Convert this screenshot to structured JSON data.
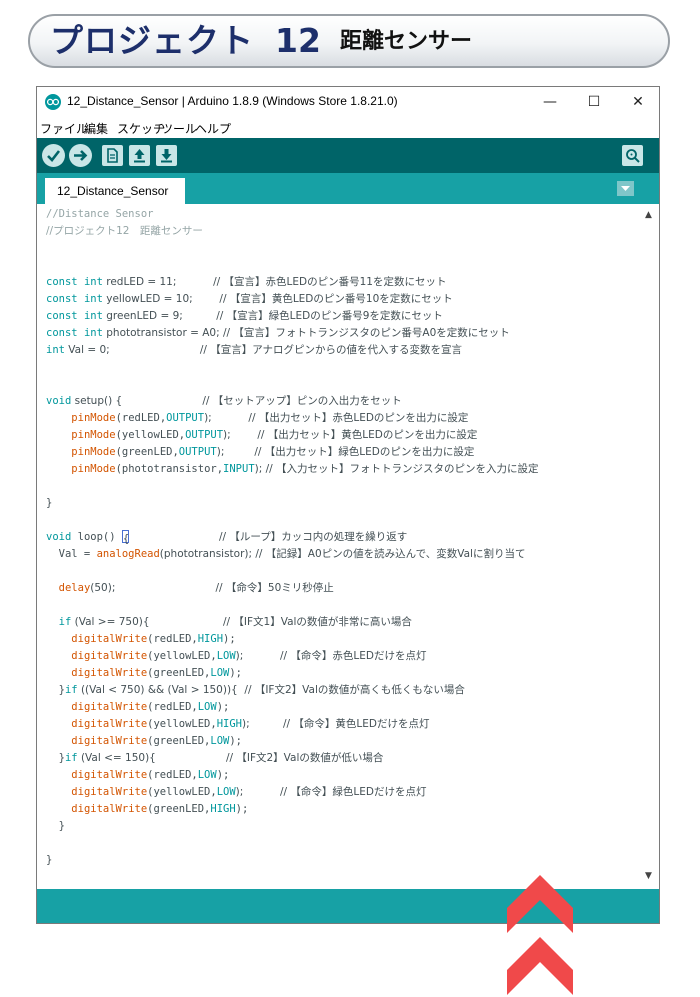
{
  "banner": {
    "project": "プロジェクト",
    "number": "12",
    "subtitle": "距離センサー"
  },
  "window": {
    "title": "12_Distance_Sensor | Arduino 1.8.9 (Windows Store 1.8.21.0)",
    "controls": {
      "minimize": "—",
      "maximize": "☐",
      "close": "✕"
    }
  },
  "menu": [
    "ファイル",
    "編集",
    "スケッチ",
    "ツール",
    "ヘルプ"
  ],
  "toolbar": {
    "icons": [
      "verify-icon",
      "upload-icon",
      "new-icon",
      "open-icon",
      "save-icon",
      "serial-monitor-icon"
    ]
  },
  "tab": {
    "label": "12_Distance_Sensor"
  },
  "colors": {
    "toolbar": "#006468",
    "tabbar": "#17a1a5",
    "keyword": "#00979c",
    "function": "#d35400",
    "comment": "#95a5a6",
    "arrow": "#f0494a"
  },
  "code": {
    "l1": "//Distance Sensor",
    "l2": "//プロジェクト12　距離センサー",
    "l5a": "const",
    "l5b": "int",
    "l5c": " redLED = 11;           // 【宣言】赤色LEDのピン番号11を定数にセット",
    "l6a": "const",
    "l6b": "int",
    "l6c": " yellowLED = 10;        // 【宣言】黄色LEDのピン番号10を定数にセット",
    "l7a": "const",
    "l7b": "int",
    "l7c": " greenLED = 9;          // 【宣言】緑色LEDのピン番号9を定数にセット",
    "l8a": "const",
    "l8b": "int",
    "l8c": " phototransistor = A0; // 【宣言】フォトトランジスタのピン番号A0を定数にセット",
    "l9a": "int",
    "l9b": " Val = 0;                           // 【宣言】アナログピンからの値を代入する変数を宣言",
    "l12a": "void",
    "l12b": " setup() {                        // 【セットアップ】ピンの入出力をセット",
    "l13a": "    ",
    "l13b": "pinMode",
    "l13c": "(redLED,",
    "l13d": "OUTPUT",
    "l13e": ");           // 【出力セット】赤色LEDのピンを出力に設定",
    "l14a": "    ",
    "l14b": "pinMode",
    "l14c": "(yellowLED,",
    "l14d": "OUTPUT",
    "l14e": ");        // 【出力セット】黄色LEDのピンを出力に設定",
    "l15a": "    ",
    "l15b": "pinMode",
    "l15c": "(greenLED,",
    "l15d": "OUTPUT",
    "l15e": ");         // 【出力セット】緑色LEDのピンを出力に設定",
    "l16a": "    ",
    "l16b": "pinMode",
    "l16c": "(phototransistor,",
    "l16d": "INPUT",
    "l16e": "); // 【入力セット】フォトトランジスタのピンを入力に設定",
    "l18": "}",
    "l20a": "void",
    "l20b": " loop() ",
    "l20c": "{",
    "l20d": "                           // 【ループ】カッコ内の処理を繰り返す",
    "l21a": "  Val = ",
    "l21b": "analogRead",
    "l21c": "(phototransistor); // 【記録】A0ピンの値を読み込んで、変数Valに割り当て",
    "l23a": "  ",
    "l23b": "delay",
    "l23c": "(50);                              // 【命令】50ミリ秒停止",
    "l25a": "  ",
    "l25b": "if",
    "l25c": " (Val >= 750){                      // 【IF文1】Valの数値が非常に高い場合",
    "l26a": "    ",
    "l26b": "digitalWrite",
    "l26c": "(redLED,",
    "l26d": "HIGH",
    "l26e": ");",
    "l27a": "    ",
    "l27b": "digitalWrite",
    "l27c": "(yellowLED,",
    "l27d": "LOW",
    "l27e": ");           // 【命令】赤色LEDだけを点灯",
    "l28a": "    ",
    "l28b": "digitalWrite",
    "l28c": "(greenLED,",
    "l28d": "LOW",
    "l28e": ");",
    "l29a": "  }",
    "l29b": "if",
    "l29c": " ((Val < 750) && (Val > 150)){  // 【IF文2】Valの数値が高くも低くもない場合",
    "l30a": "    ",
    "l30b": "digitalWrite",
    "l30c": "(redLED,",
    "l30d": "LOW",
    "l30e": ");",
    "l31a": "    ",
    "l31b": "digitalWrite",
    "l31c": "(yellowLED,",
    "l31d": "HIGH",
    "l31e": ");          // 【命令】黄色LEDだけを点灯",
    "l32a": "    ",
    "l32b": "digitalWrite",
    "l32c": "(greenLED,",
    "l32d": "LOW",
    "l32e": ");",
    "l33a": "  }",
    "l33b": "if",
    "l33c": " (Val <= 150){                     // 【IF文2】Valの数値が低い場合",
    "l34a": "    ",
    "l34b": "digitalWrite",
    "l34c": "(redLED,",
    "l34d": "LOW",
    "l34e": ");",
    "l35a": "    ",
    "l35b": "digitalWrite",
    "l35c": "(yellowLED,",
    "l35d": "LOW",
    "l35e": ");           // 【命令】緑色LEDだけを点灯",
    "l36a": "    ",
    "l36b": "digitalWrite",
    "l36c": "(greenLED,",
    "l36d": "HIGH",
    "l36e": ");",
    "l37": "  }",
    "l39": "}"
  }
}
